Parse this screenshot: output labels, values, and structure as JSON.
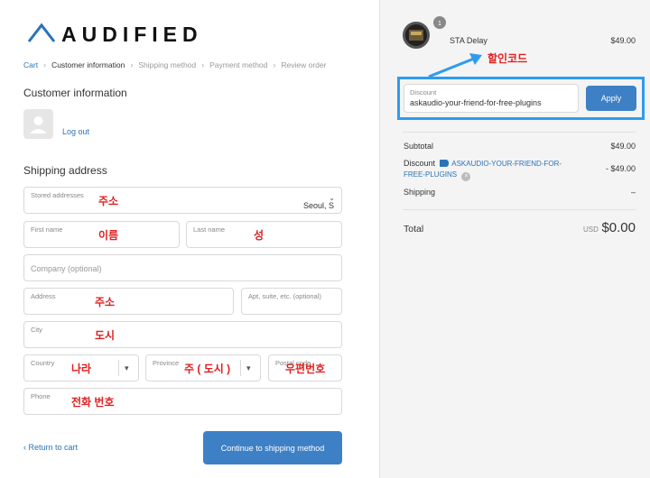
{
  "brand": {
    "logo_text": "AUDIFIED"
  },
  "breadcrumb": {
    "cart": "Cart",
    "customer": "Customer information",
    "shipping": "Shipping method",
    "payment": "Payment method",
    "review": "Review order"
  },
  "customer": {
    "title": "Customer information",
    "logout": "Log out"
  },
  "shipping": {
    "title": "Shipping address",
    "stored_label": "Stored addresses",
    "stored_value": "Seoul, S",
    "stored_ann": "주소",
    "first_label": "First name",
    "first_ann": "이름",
    "last_label": "Last name",
    "last_ann": "성",
    "company_placeholder": "Company (optional)",
    "address_label": "Address",
    "address_ann": "주소",
    "apt_label": "Apt, suite, etc. (optional)",
    "city_label": "City",
    "city_ann": "도시",
    "country_label": "Country",
    "country_ann": "나라",
    "province_label": "Province",
    "province_ann": "주 ( 도시 )",
    "postal_label": "Postal code",
    "postal_ann": "우편번호",
    "phone_label": "Phone",
    "phone_ann": "전화 번호"
  },
  "actions": {
    "back": "Return to cart",
    "continue": "Continue to shipping method"
  },
  "order": {
    "qty": "1",
    "product": "STA Delay",
    "price": "$49.00",
    "discount_annotation": "할인코드",
    "discount_label": "Discount",
    "discount_value": "askaudio-your-friend-for-free-plugins",
    "apply": "Apply",
    "subtotal_label": "Subtotal",
    "subtotal_value": "$49.00",
    "discount_row_label": "Discount",
    "discount_code": "ASKAUDIO-YOUR-FRIEND-FOR-FREE-PLUGINS",
    "discount_amount": "- $49.00",
    "shipping_label": "Shipping",
    "shipping_value": "–",
    "total_label": "Total",
    "total_currency": "USD",
    "total_value": "$0.00"
  },
  "colors": {
    "accent": "#3d80c6",
    "link": "#2a73b8",
    "annotation": "#e02020",
    "highlight_box": "#2f9bf0"
  },
  "icons": {
    "user": "user-icon",
    "tag": "tag-icon",
    "remove": "remove-icon",
    "caret": "chevron-down-icon"
  }
}
